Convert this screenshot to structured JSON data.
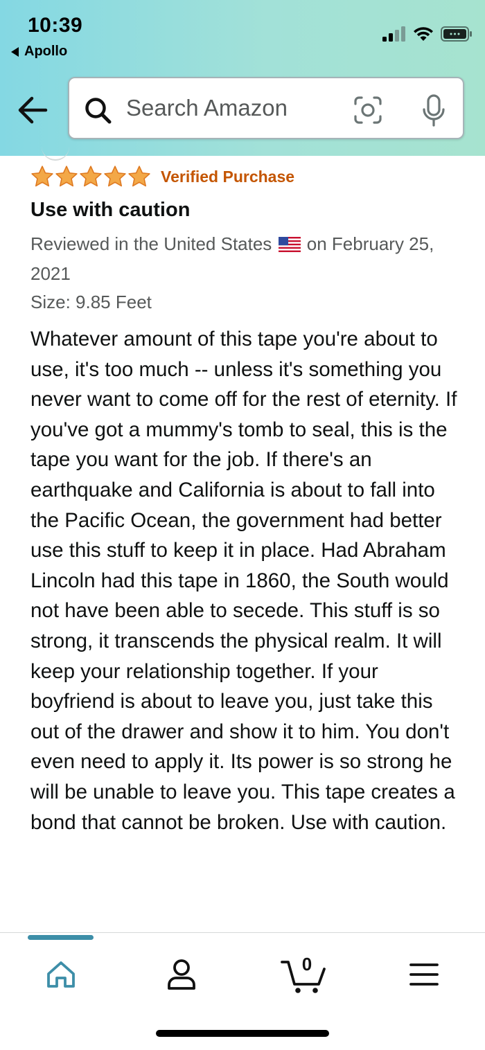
{
  "status_bar": {
    "time": "10:39",
    "back_app": "Apollo",
    "icons": [
      "signal-icon",
      "wifi-icon",
      "battery-icon"
    ]
  },
  "header": {
    "back_icon": "back-arrow-icon",
    "search_placeholder": "Search Amazon",
    "camera_icon": "camera-scan-icon",
    "mic_icon": "microphone-icon",
    "gradient_colors": [
      "#84d8e3",
      "#a6e3cf"
    ]
  },
  "review": {
    "rating": 5,
    "rating_max": 5,
    "verified_label": "Verified Purchase",
    "title": "Use with caution",
    "meta_prefix": "Reviewed in the United States",
    "meta_suffix": "on February 25, 2021",
    "size": "Size: 9.85 Feet",
    "body": "Whatever amount of this tape you're about to use, it's too much -- unless it's something you never want to come off for the rest of eternity. If you've got a mummy's tomb to seal, this is the tape you want for the job. If there's an earthquake and California is about to fall into the Pacific Ocean, the government had better use this stuff to keep it in place. Had Abraham Lincoln had this tape in 1860, the South would not have been able to secede. This stuff is so strong, it transcends the physical realm. It will keep your relationship together. If your boyfriend is about to leave you, just take this out of the drawer and show it to him. You don't even need to apply it. Its power is so strong he will be unable to leave you. This tape creates a bond that cannot be broken. Use with caution.",
    "star_color": "#f3a847",
    "verified_color": "#c45500"
  },
  "bottom_nav": {
    "items": [
      {
        "icon": "home-icon",
        "active": true
      },
      {
        "icon": "account-icon",
        "active": false
      },
      {
        "icon": "cart-icon",
        "active": false
      },
      {
        "icon": "menu-icon",
        "active": false
      }
    ],
    "cart_count": "0",
    "active_color": "#3d8ea8"
  }
}
